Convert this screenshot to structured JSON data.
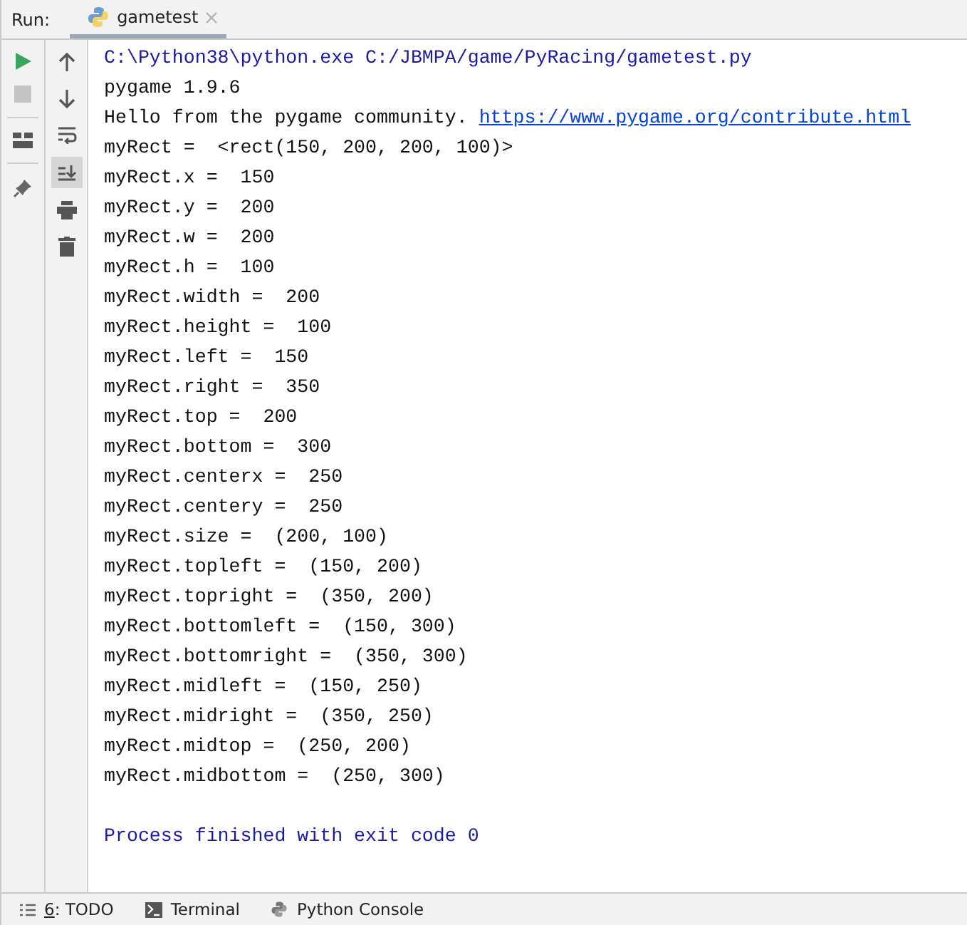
{
  "run_panel": {
    "label": "Run:",
    "tabs": [
      {
        "label": "gametest",
        "selected": true
      }
    ]
  },
  "left_toolbar": [
    {
      "kind": "run"
    },
    {
      "kind": "stop",
      "disabled": true
    },
    {
      "kind": "sep"
    },
    {
      "kind": "layout"
    },
    {
      "kind": "sep"
    },
    {
      "kind": "pin"
    }
  ],
  "console_toolbar": [
    {
      "kind": "up",
      "on": false
    },
    {
      "kind": "down",
      "on": false
    },
    {
      "kind": "wrap",
      "on": false
    },
    {
      "kind": "scroll-end",
      "on": true
    },
    {
      "kind": "print",
      "on": false
    },
    {
      "kind": "trash",
      "on": false
    }
  ],
  "console_lines": [
    {
      "kind": "command",
      "text": "C:\\Python38\\python.exe C:/JBMPA/game/PyRacing/gametest.py"
    },
    {
      "kind": "output",
      "text": "pygame 1.9.6"
    },
    {
      "kind": "output",
      "text": "Hello from the pygame community. ",
      "link": "https://www.pygame.org/contribute.html"
    },
    {
      "kind": "output",
      "text": "myRect =  <rect(150, 200, 200, 100)>"
    },
    {
      "kind": "output",
      "text": "myRect.x =  150"
    },
    {
      "kind": "output",
      "text": "myRect.y =  200"
    },
    {
      "kind": "output",
      "text": "myRect.w =  200"
    },
    {
      "kind": "output",
      "text": "myRect.h =  100"
    },
    {
      "kind": "output",
      "text": "myRect.width =  200"
    },
    {
      "kind": "output",
      "text": "myRect.height =  100"
    },
    {
      "kind": "output",
      "text": "myRect.left =  150"
    },
    {
      "kind": "output",
      "text": "myRect.right =  350"
    },
    {
      "kind": "output",
      "text": "myRect.top =  200"
    },
    {
      "kind": "output",
      "text": "myRect.bottom =  300"
    },
    {
      "kind": "output",
      "text": "myRect.centerx =  250"
    },
    {
      "kind": "output",
      "text": "myRect.centery =  250"
    },
    {
      "kind": "output",
      "text": "myRect.size =  (200, 100)"
    },
    {
      "kind": "output",
      "text": "myRect.topleft =  (150, 200)"
    },
    {
      "kind": "output",
      "text": "myRect.topright =  (350, 200)"
    },
    {
      "kind": "output",
      "text": "myRect.bottomleft =  (150, 300)"
    },
    {
      "kind": "output",
      "text": "myRect.bottomright =  (350, 300)"
    },
    {
      "kind": "output",
      "text": "myRect.midleft =  (150, 250)"
    },
    {
      "kind": "output",
      "text": "myRect.midright =  (350, 250)"
    },
    {
      "kind": "output",
      "text": "myRect.midtop =  (250, 200)"
    },
    {
      "kind": "output",
      "text": "myRect.midbottom =  (250, 300)"
    },
    {
      "kind": "blank"
    },
    {
      "kind": "status",
      "text": "Process finished with exit code 0"
    }
  ],
  "bottom_tabs": [
    {
      "kind": "todo",
      "mnemonic": "6",
      "label": ": TODO"
    },
    {
      "kind": "terminal",
      "label": "Terminal"
    },
    {
      "kind": "python",
      "label": "Python Console"
    }
  ]
}
